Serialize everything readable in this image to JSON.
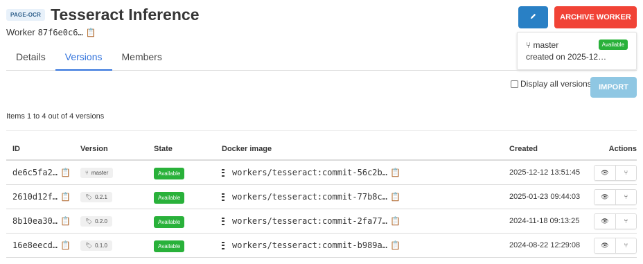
{
  "header": {
    "type_tag": "PAGE-OCR",
    "title": "Tesseract Inference",
    "subtitle_label": "Worker",
    "worker_id": "87f6e0c6…"
  },
  "tabs": [
    {
      "label": "Details",
      "active": false
    },
    {
      "label": "Versions",
      "active": true
    },
    {
      "label": "Members",
      "active": false
    }
  ],
  "buttons": {
    "archive": "ARCHIVE WORKER",
    "import": "IMPORT"
  },
  "version_card": {
    "branch": "master",
    "state": "Available",
    "created": "created on 2025-12…"
  },
  "filter": {
    "display_all_label": "Display all versions",
    "display_all_checked": false
  },
  "items_count": "Items 1 to 4 out of 4 versions",
  "table": {
    "columns": [
      "ID",
      "Version",
      "State",
      "Docker image",
      "Created",
      "Actions"
    ],
    "rows": [
      {
        "id": "de6c5fa2…",
        "version": "master",
        "version_kind": "branch",
        "state": "Available",
        "image": "workers/tesseract:commit-56c2b…",
        "created": "2025-12-12 13:51:45"
      },
      {
        "id": "2610d12f…",
        "version": "0.2.1",
        "version_kind": "tag",
        "state": "Available",
        "image": "workers/tesseract:commit-77b8c…",
        "created": "2025-01-23 09:44:03"
      },
      {
        "id": "8b10ea30…",
        "version": "0.2.0",
        "version_kind": "tag",
        "state": "Available",
        "image": "workers/tesseract:commit-2fa77…",
        "created": "2024-11-18 09:13:25"
      },
      {
        "id": "16e8eecd…",
        "version": "0.1.0",
        "version_kind": "tag",
        "state": "Available",
        "image": "workers/tesseract:commit-b989a…",
        "created": "2024-08-22 12:29:08"
      }
    ]
  },
  "colors": {
    "primary": "#2980c5",
    "danger": "#f14336",
    "success": "#29b13a",
    "link": "#3273dc",
    "import_disabled": "#8fc7e3"
  },
  "icons": {
    "edit": "pencil-icon",
    "copy": "clipboard-icon",
    "branch": "branch-icon",
    "tag": "tag-icon",
    "image": "docker-image-icon",
    "view": "eye-icon"
  }
}
